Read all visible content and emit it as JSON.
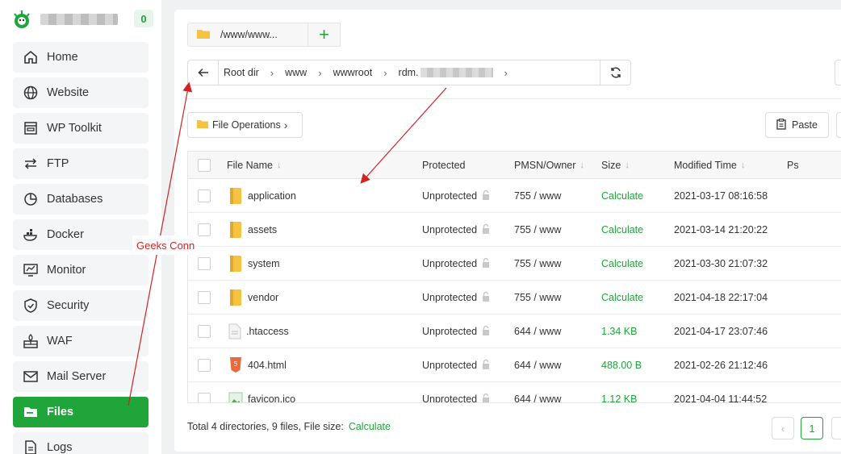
{
  "sidebar": {
    "badge": "0",
    "items": [
      {
        "label": "Home",
        "icon": "home-icon"
      },
      {
        "label": "Website",
        "icon": "globe-icon"
      },
      {
        "label": "WP Toolkit",
        "icon": "wp-toolkit-icon"
      },
      {
        "label": "FTP",
        "icon": "transfer-arrows-icon"
      },
      {
        "label": "Databases",
        "icon": "pie-chart-icon"
      },
      {
        "label": "Docker",
        "icon": "docker-whale-icon"
      },
      {
        "label": "Monitor",
        "icon": "monitor-icon"
      },
      {
        "label": "Security",
        "icon": "shield-check-icon"
      },
      {
        "label": "WAF",
        "icon": "firewall-icon"
      },
      {
        "label": "Mail Server",
        "icon": "mail-icon"
      },
      {
        "label": "Files",
        "icon": "file-folder-icon",
        "active": true
      },
      {
        "label": "Logs",
        "icon": "log-document-icon"
      }
    ]
  },
  "tab": {
    "label": "/www/www..."
  },
  "breadcrumb": {
    "items": [
      "Root dir",
      "www",
      "wwwroot",
      "rdm."
    ]
  },
  "toolbar": {
    "file_operations": "File Operations",
    "paste": "Paste"
  },
  "table": {
    "columns": [
      "File Name",
      "Protected",
      "PMSN/Owner",
      "Size",
      "Modified Time",
      "Ps"
    ],
    "rows": [
      {
        "name": "application",
        "type": "folder",
        "protected": "Unprotected",
        "perm": "755 / www",
        "size": "Calculate",
        "modified": "2021-03-17 08:16:58"
      },
      {
        "name": "assets",
        "type": "folder",
        "protected": "Unprotected",
        "perm": "755 / www",
        "size": "Calculate",
        "modified": "2021-03-14 21:20:22"
      },
      {
        "name": "system",
        "type": "folder",
        "protected": "Unprotected",
        "perm": "755 / www",
        "size": "Calculate",
        "modified": "2021-03-30 21:07:32"
      },
      {
        "name": "vendor",
        "type": "folder",
        "protected": "Unprotected",
        "perm": "755 / www",
        "size": "Calculate",
        "modified": "2021-04-18 22:17:04"
      },
      {
        "name": ".htaccess",
        "type": "text",
        "protected": "Unprotected",
        "perm": "644 / www",
        "size": "1.34 KB",
        "modified": "2021-04-17 23:07:46"
      },
      {
        "name": "404.html",
        "type": "html",
        "protected": "Unprotected",
        "perm": "644 / www",
        "size": "488.00 B",
        "modified": "2021-02-26 21:12:46"
      },
      {
        "name": "favicon.ico",
        "type": "image",
        "protected": "Unprotected",
        "perm": "644 / www",
        "size": "1.12 KB",
        "modified": "2021-04-04 11:44:52"
      }
    ]
  },
  "footer": {
    "summary": "Total 4 directories, 9 files, File size:",
    "calculate": "Calculate"
  },
  "pagination": {
    "current": "1"
  },
  "annotation": {
    "label": "Geeks Conn"
  },
  "colors": {
    "accent": "#20a53a",
    "annotation": "#d22222"
  }
}
